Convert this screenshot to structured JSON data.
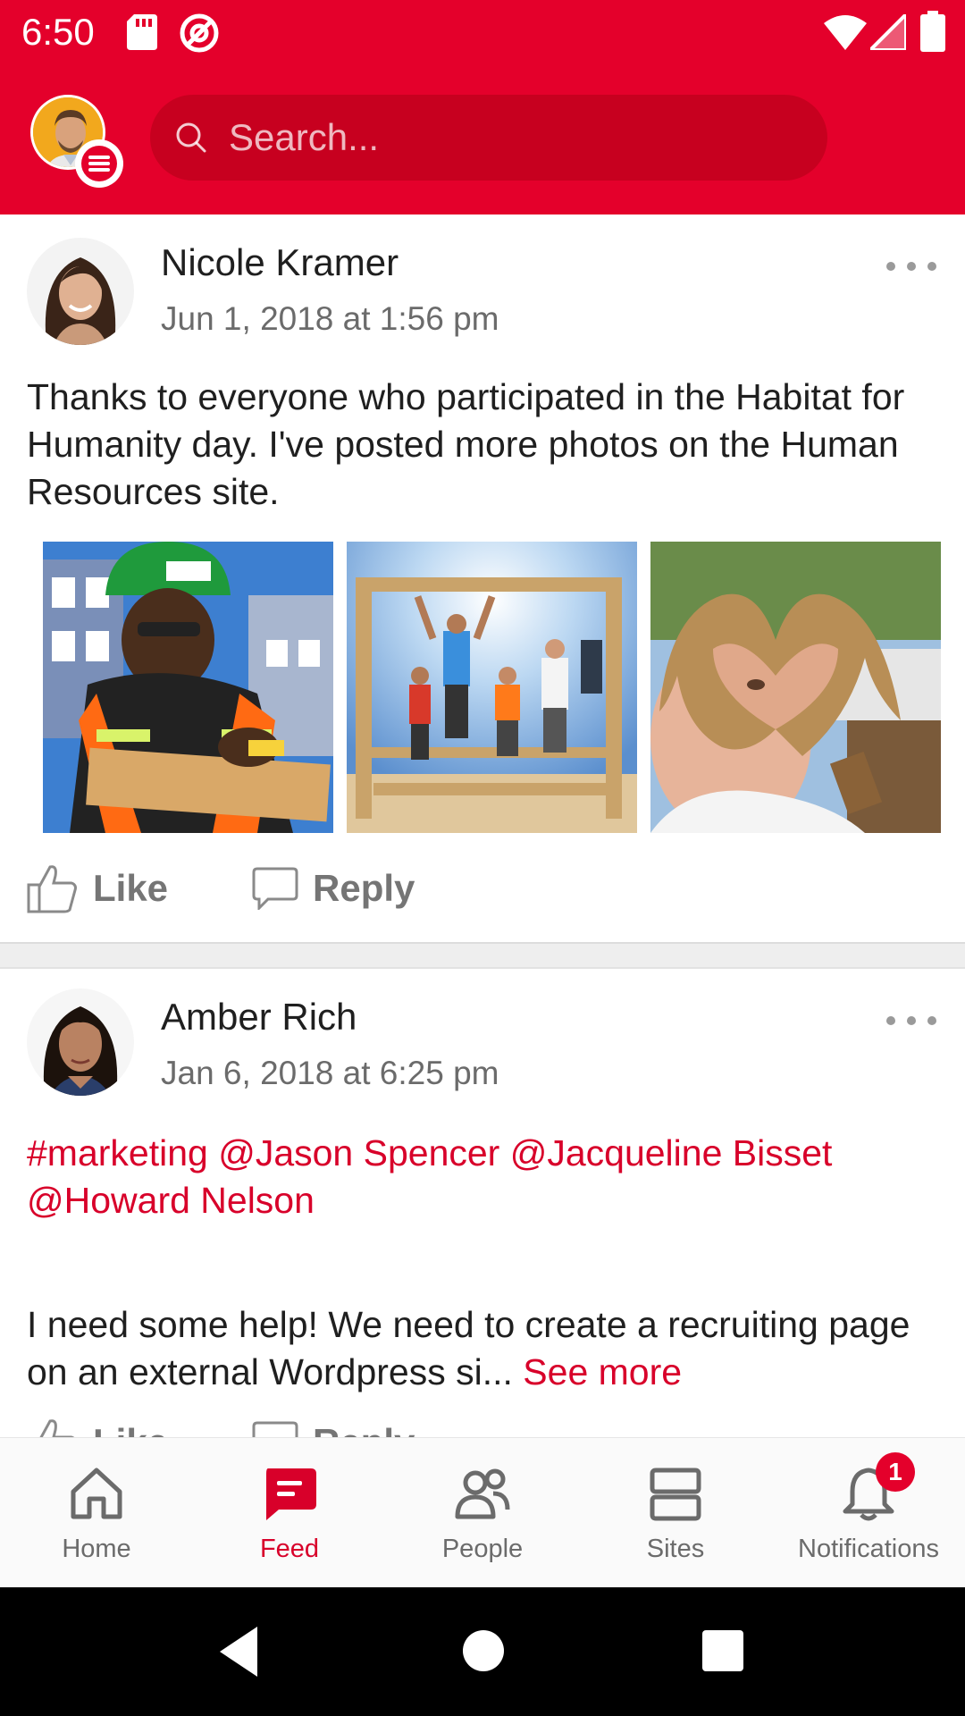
{
  "status_bar": {
    "time": "6:50",
    "icons": [
      "sd-card-icon",
      "at-sign-icon",
      "wifi-icon",
      "cell-signal-icon",
      "battery-icon"
    ],
    "background": "#e4002b"
  },
  "header": {
    "menu_icon": "hamburger-menu-icon",
    "search": {
      "placeholder": "Search...",
      "value": ""
    },
    "accent": "#e4002b"
  },
  "feed": {
    "posts": [
      {
        "author": "Nicole Kramer",
        "timestamp": "Jun 1, 2018 at 1:56 pm",
        "text": "Thanks to everyone who participated in the Habitat for Humanity day. I've posted more photos on the Human Resources site.",
        "photos": [
          "photo-worker-hardhat",
          "photo-volunteers-frame",
          "photo-gloved-heart"
        ],
        "like_label": "Like",
        "reply_label": "Reply"
      },
      {
        "author": "Amber Rich",
        "timestamp": "Jan 6, 2018 at 6:25 pm",
        "tags": "#marketing @Jason Spencer @Jacqueline Bisset @Howard Nelson",
        "text": "I need some help! We need to create a recruiting page on an external Wordpress si...",
        "see_more": "See more",
        "like_label": "Like",
        "reply_label": "Reply"
      }
    ]
  },
  "bottom_nav": {
    "items": [
      {
        "label": "Home",
        "icon": "home-icon",
        "active": false
      },
      {
        "label": "Feed",
        "icon": "feed-chat-icon",
        "active": true
      },
      {
        "label": "People",
        "icon": "people-icon",
        "active": false
      },
      {
        "label": "Sites",
        "icon": "sites-icon",
        "active": false
      },
      {
        "label": "Notifications",
        "icon": "bell-icon",
        "active": false,
        "badge": "1"
      }
    ],
    "active_color": "#d8002a",
    "inactive_color": "#6b6b6b"
  },
  "system_nav": {
    "icons": [
      "back-triangle-icon",
      "home-circle-icon",
      "recents-square-icon"
    ]
  }
}
